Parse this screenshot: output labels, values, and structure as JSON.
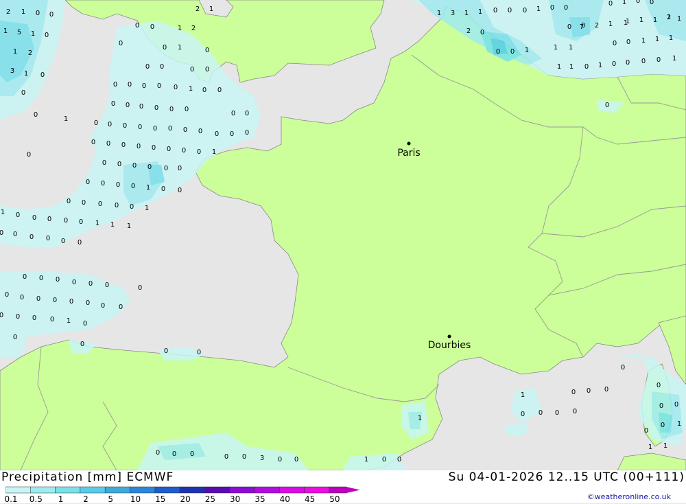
{
  "header": {
    "title": "Precipitation [mm] ECMWF",
    "datetime": "Su 04-01-2026 12..15 UTC (00+111)",
    "credit": "©weatheronline.co.uk"
  },
  "cities": [
    {
      "name": "Paris"
    },
    {
      "name": "Dourbies"
    }
  ],
  "legend": {
    "ticks": [
      "0.1",
      "0.5",
      "1",
      "2",
      "5",
      "10",
      "15",
      "20",
      "25",
      "30",
      "35",
      "40",
      "45",
      "50"
    ],
    "colors": [
      "#c8f5f5",
      "#a0ebf0",
      "#78e1eb",
      "#55cdeb",
      "#3caadc",
      "#2887dc",
      "#1e5ad2",
      "#1e32b4",
      "#5a0ab4",
      "#8c0adc",
      "#b40ae6",
      "#dc0ae6",
      "#f00ae6",
      "#be00be"
    ]
  },
  "colors": {
    "land": "#ccff99",
    "sea": "#e6e6e6",
    "border": "#999999",
    "coast": "#888888"
  },
  "values": [
    "2",
    "1",
    "0",
    "0",
    "2",
    "1",
    "1",
    "3",
    "1",
    "1",
    "0",
    "0",
    "0",
    "1",
    "0",
    "0",
    "0",
    "1",
    "0",
    "0",
    "1",
    "5",
    "1",
    "0",
    "1",
    "2",
    "0",
    "2",
    "1",
    "1",
    "7",
    "0",
    "1",
    "1",
    "1",
    "1",
    "1",
    "0",
    "0",
    "2",
    "0",
    "0",
    "3",
    "1",
    "0",
    "0",
    "1",
    "0",
    "1",
    "2",
    "2",
    "0",
    "0",
    "0",
    "1",
    "1",
    "1",
    "1",
    "1",
    "1",
    "1",
    "1",
    "0",
    "1",
    "0",
    "0",
    "0",
    "0",
    "1",
    "0",
    "0",
    "0",
    "0",
    "0",
    "0",
    "0",
    "0",
    "0",
    "0",
    "1",
    "0",
    "0",
    "0",
    "0",
    "0",
    "0",
    "0",
    "0",
    "0",
    "0",
    "0",
    "1",
    "0",
    "0",
    "0",
    "0",
    "0",
    "0",
    "0",
    "0",
    "0",
    "0",
    "0",
    "0",
    "0",
    "0",
    "0",
    "0",
    "0",
    "0",
    "0",
    "0",
    "0",
    "1",
    "0",
    "0",
    "0",
    "0",
    "0",
    "0",
    "0",
    "0",
    "0",
    "0",
    "0",
    "1",
    "0",
    "0",
    "0",
    "0",
    "0",
    "0",
    "0",
    "1",
    "1",
    "0",
    "0",
    "0",
    "0",
    "0",
    "1",
    "1",
    "1",
    "0",
    "0",
    "0",
    "0",
    "0",
    "0",
    "0",
    "0",
    "0",
    "0",
    "0",
    "0",
    "0",
    "0",
    "0",
    "0",
    "0",
    "0",
    "0",
    "0",
    "0",
    "0",
    "0",
    "0",
    "0",
    "1",
    "0",
    "0",
    "0",
    "0",
    "0",
    "0",
    "0",
    "0",
    "0",
    "0",
    "1",
    "0",
    "0",
    "0",
    "0",
    "1",
    "0",
    "0",
    "0",
    "0",
    "1",
    "1",
    "1",
    "0",
    "0",
    "0",
    "0",
    "0",
    "3",
    "0",
    "0",
    "1",
    "0",
    "0",
    "1",
    "1",
    "0",
    "0",
    "0",
    "0"
  ]
}
